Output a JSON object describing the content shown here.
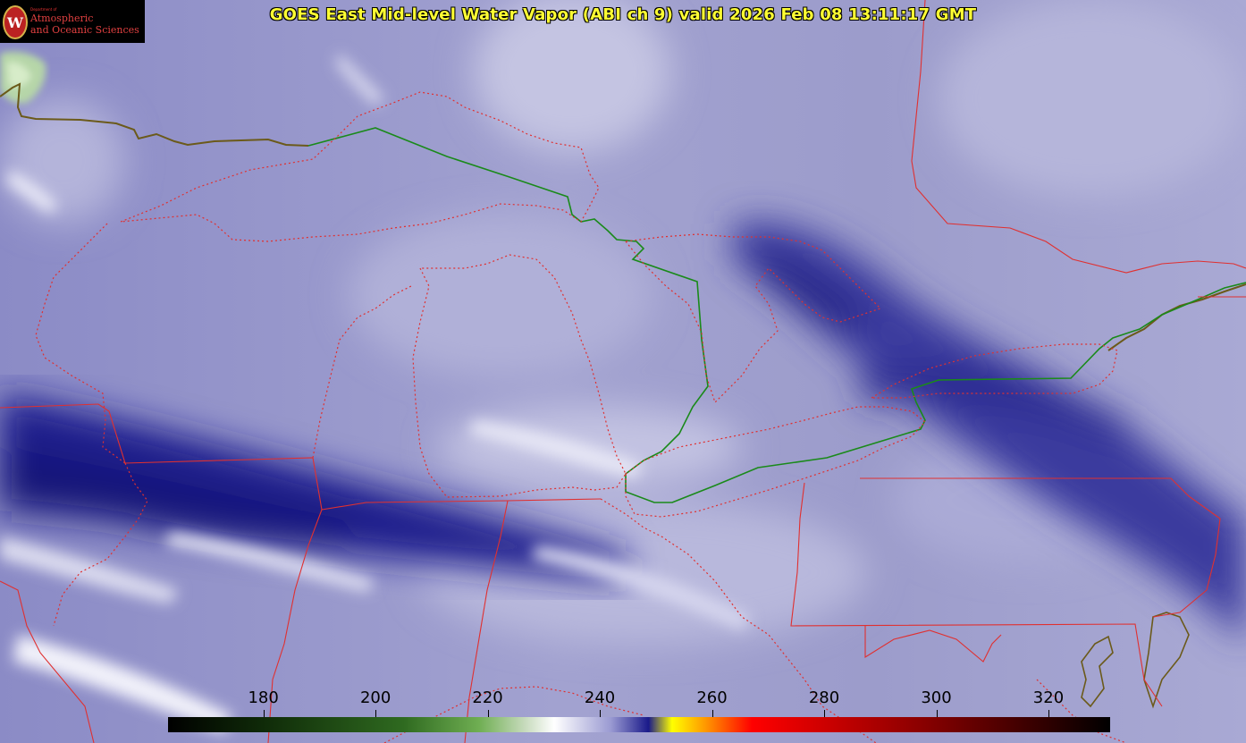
{
  "title": "GOES East Mid-level Water Vapor (ABI ch 9)  valid 2026 Feb 08 13:11:17 GMT",
  "logo": {
    "dept_line": "Department of",
    "line1": "Atmospheric",
    "line2": "and Oceanic Sciences",
    "seal_letter": "W"
  },
  "colorbar": {
    "units_ticks": [
      "180",
      "200",
      "220",
      "240",
      "260",
      "280",
      "300",
      "320"
    ],
    "tick_values": [
      180,
      200,
      220,
      240,
      260,
      280,
      300,
      320
    ],
    "range": [
      163,
      331
    ]
  },
  "colors": {
    "title": "#ffff33",
    "state_borders": "#e03030",
    "international_border": "#1a8a1a",
    "coastline": "#6b5a1a"
  }
}
